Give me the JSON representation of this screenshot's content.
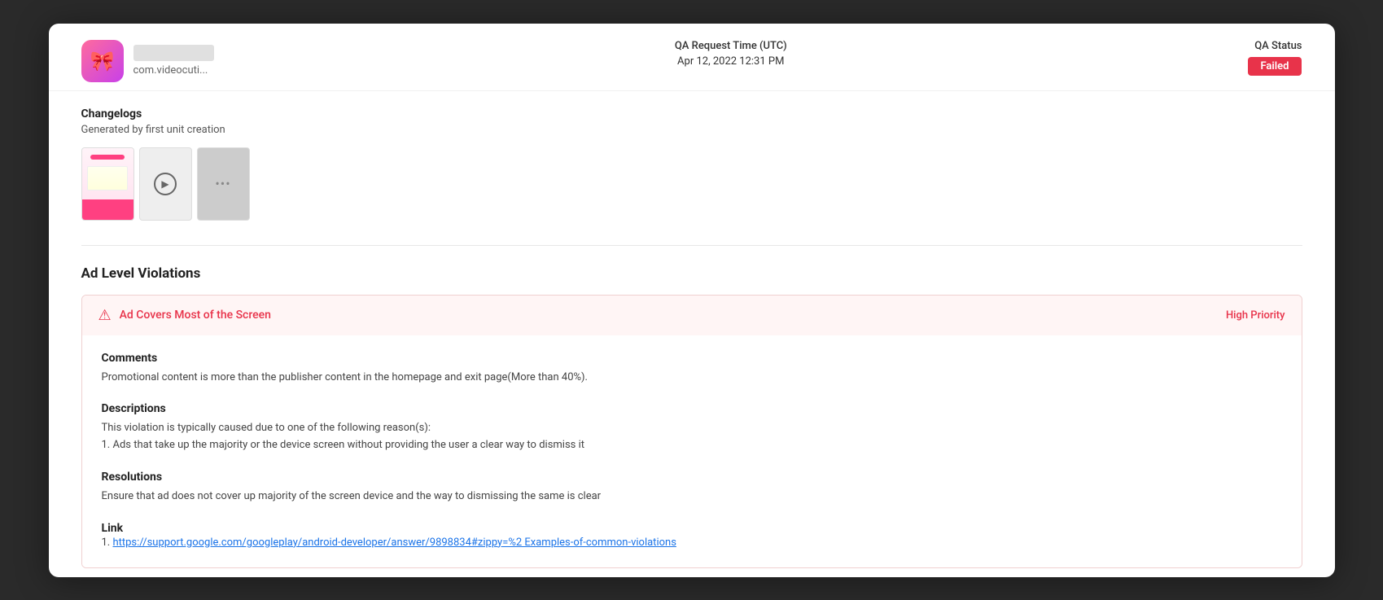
{
  "window": {
    "background": "#2a2a2a"
  },
  "header": {
    "app_icon_emoji": "🎀",
    "app_name_placeholder": "···················",
    "app_package": "com.videocuti...",
    "qa_request_label": "QA Request Time (UTC)",
    "qa_request_date": "Apr 12, 2022 12:31 PM",
    "qa_status_label": "QA Status",
    "qa_status_value": "Failed"
  },
  "changelogs": {
    "title": "Changelogs",
    "subtitle": "Generated by first unit creation",
    "media_items": [
      {
        "type": "image",
        "label": "screenshot-1"
      },
      {
        "type": "video",
        "label": "video-1"
      },
      {
        "type": "more",
        "label": "more-media"
      }
    ]
  },
  "ad_violations": {
    "section_title": "Ad Level Violations",
    "violations": [
      {
        "title": "Ad Covers Most of the Screen",
        "priority": "High Priority",
        "comments_label": "Comments",
        "comments_text": "Promotional content is more than the publisher content in the homepage and exit page(More than 40%).",
        "descriptions_label": "Descriptions",
        "descriptions_text": "This violation is typically caused due to one of the following reason(s):\n1. Ads that take up the majority or the device screen without providing the user a clear way to dismiss it",
        "resolutions_label": "Resolutions",
        "resolutions_text": "Ensure that ad does not cover up majority of the screen device and the way to dismissing the same is clear",
        "link_label": "Link",
        "link_text": "https://support.google.com/googleplay/android-developer/answer/9898834#zippy=%2 Examples-of-common-violations"
      }
    ]
  }
}
